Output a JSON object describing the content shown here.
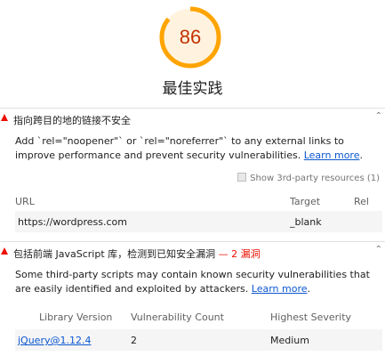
{
  "score": {
    "value": "86",
    "fraction": 0.86,
    "color": "#ffa400"
  },
  "category_title": "最佳实践",
  "audit1": {
    "title": "指向跨目的地的链接不安全",
    "desc_part1": "Add `rel=\"noopener\"` or `rel=\"noreferrer\"` to any external links to improve performance and prevent security vulnerabilities. ",
    "learn_more": "Learn more",
    "desc_end": ".",
    "third_party_label": "Show 3rd-party resources (1)",
    "columns": [
      "URL",
      "Target",
      "Rel"
    ],
    "row": {
      "url": "https://wordpress.com",
      "target": "_blank",
      "rel": ""
    }
  },
  "audit2": {
    "title_prefix": "包括前端 JavaScript 库，检测到已知安全漏洞",
    "title_suffix": "— 2 漏洞",
    "desc_part1": "Some third-party scripts may contain known security vulnerabilities that are easily identified and exploited by attackers. ",
    "learn_more": "Learn more",
    "desc_end": ".",
    "columns": [
      "Library Version",
      "Vulnerability Count",
      "Highest Severity"
    ],
    "row": {
      "library": "jQuery@1.12.4",
      "count": "2",
      "severity": "Medium"
    }
  },
  "colors": {
    "fail": "#eb0f00",
    "link": "#0b57d0",
    "score_text": "#c33300"
  },
  "icons": {
    "fail": "red-triangle-icon",
    "collapse": "chevron-up-icon"
  }
}
